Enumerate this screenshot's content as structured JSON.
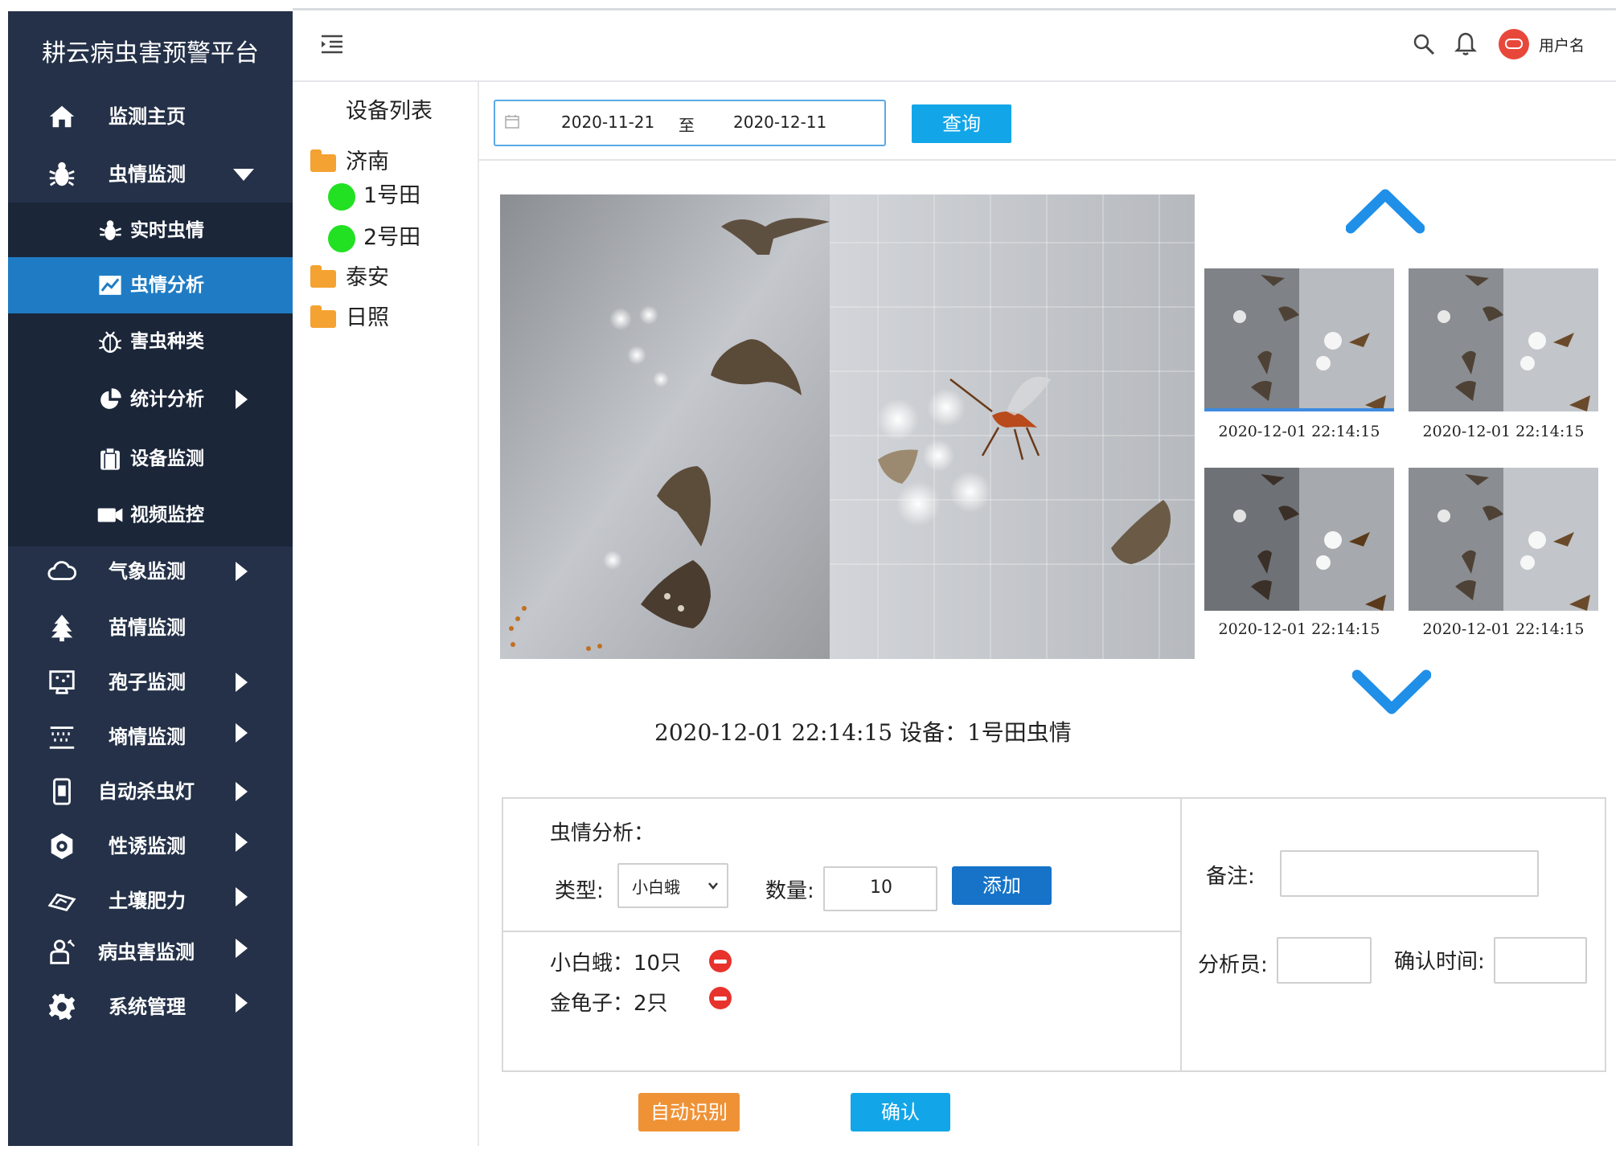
{
  "app": {
    "title": "耕云病虫害预警平台"
  },
  "nav": {
    "home": "监测主页",
    "pest_monitor": "虫情监测",
    "sub": {
      "realtime": "实时虫情",
      "analysis": "虫情分析",
      "species": "害虫种类",
      "stats": "统计分析",
      "device": "设备监测",
      "video": "视频监控"
    },
    "weather": "气象监测",
    "seedling": "苗情监测",
    "spore": "孢子监测",
    "soil_moisture": "墒情监测",
    "insect_lamp": "自动杀虫灯",
    "pheromone": "性诱监测",
    "soil_fertility": "土壤肥力",
    "disease": "病虫害监测",
    "system": "系统管理"
  },
  "topbar": {
    "username": "用户名",
    "icons": [
      "menu-indent-icon",
      "search-icon",
      "bell-icon",
      "avatar"
    ]
  },
  "device_list": {
    "title": "设备列表",
    "groups": [
      {
        "name": "济南",
        "devices": [
          "1号田",
          "2号田"
        ]
      },
      {
        "name": "泰安"
      },
      {
        "name": "日照"
      }
    ]
  },
  "filter": {
    "start": "2020-11-21",
    "sep": "至",
    "end": "2020-12-11",
    "query_label": "查询"
  },
  "thumbnails": [
    {
      "time": "2020-12-01 22:14:15"
    },
    {
      "time": "2020-12-01 22:14:15"
    },
    {
      "time": "2020-12-01 22:14:15"
    },
    {
      "time": "2020-12-01 22:14:15"
    }
  ],
  "caption": "2020-12-01 22:14:15  设备：1号田虫情",
  "analysis": {
    "title": "虫情分析：",
    "type_label": "类型:",
    "type_value": "小白蛾",
    "count_label": "数量:",
    "count_value": "10",
    "add_label": "添加",
    "items": [
      "小白蛾：10只",
      "金龟子：2只"
    ],
    "remark_label": "备注:",
    "analyst_label": "分析员:",
    "confirm_time_label": "确认时间:",
    "auto_label": "自动识别",
    "confirm_label": "确认"
  },
  "colors": {
    "sidebar": "#243148",
    "active": "#1f7cc4",
    "query": "#12a6e8",
    "add": "#1673c8",
    "auto": "#ef9236",
    "confirm": "#12a6e8"
  }
}
